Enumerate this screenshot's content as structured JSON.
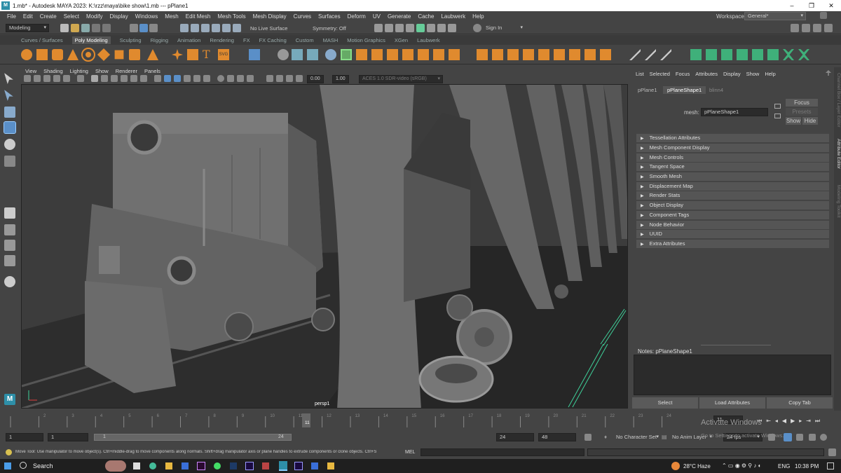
{
  "titlebar": {
    "title": "1.mb* - Autodesk MAYA 2023: K:\\rzz\\maya\\bike show\\1.mb  ---  pPlane1",
    "minimize": "–",
    "maximize": "❐",
    "close": "✕"
  },
  "menubar": [
    "File",
    "Edit",
    "Create",
    "Select",
    "Modify",
    "Display",
    "Windows",
    "Mesh",
    "Edit Mesh",
    "Mesh Tools",
    "Mesh Display",
    "Curves",
    "Surfaces",
    "Deform",
    "UV",
    "Generate",
    "Cache",
    "Laubwerk",
    "Help"
  ],
  "workspace": {
    "label": "Workspace:",
    "value": "General*"
  },
  "statusline": {
    "mode": "Modeling",
    "live_surface": "No Live Surface",
    "symmetry": "Symmetry: Off",
    "sign_in": "Sign In"
  },
  "shelf_tabs": [
    "Curves / Surfaces",
    "Poly Modeling",
    "Sculpting",
    "Rigging",
    "Animation",
    "Rendering",
    "FX",
    "FX Caching",
    "Custom",
    "MASH",
    "Motion Graphics",
    "XGen",
    "Laubwerk"
  ],
  "shelf_active": "Poly Modeling",
  "viewport": {
    "menu": [
      "View",
      "Shading",
      "Lighting",
      "Show",
      "Renderer",
      "Panels"
    ],
    "field_a": "0.00",
    "field_b": "1.00",
    "colorspace": "ACES 1.0 SDR-video (sRGB)",
    "camera_label": "persp1"
  },
  "attribute_editor": {
    "menu": [
      "List",
      "Selected",
      "Focus",
      "Attributes",
      "Display",
      "Show",
      "Help"
    ],
    "tabs": [
      "pPlane1",
      "pPlaneShape1",
      "blinn4"
    ],
    "active_tab": "pPlaneShape1",
    "mesh_label": "mesh:",
    "mesh_value": "pPlaneShape1",
    "focus": "Focus",
    "presets": "Presets",
    "show": "Show",
    "hide": "Hide",
    "sections": [
      "Tessellation Attributes",
      "Mesh Component Display",
      "Mesh Controls",
      "Tangent Space",
      "Smooth Mesh",
      "Displacement Map",
      "Render Stats",
      "Object Display",
      "Component Tags",
      "Node Behavior",
      "UUID",
      "Extra Attributes"
    ],
    "notes_label": "Notes:  pPlaneShape1",
    "buttons": [
      "Select",
      "Load Attributes",
      "Copy Tab"
    ]
  },
  "side_tabs": [
    "Channel Box / Layer Editor",
    "Attribute Editor",
    "Modeling Toolkit"
  ],
  "timeslider": {
    "ticks": [
      "1",
      "2",
      "3",
      "4",
      "5",
      "6",
      "7",
      "8",
      "9",
      "10",
      "11",
      "12",
      "13",
      "14",
      "15",
      "16",
      "17",
      "18",
      "19",
      "20",
      "21",
      "22",
      "23",
      "24"
    ],
    "current_frame": "11",
    "current_field": "11"
  },
  "range": {
    "start": "1",
    "start2": "1",
    "range_start_label": "1",
    "range_end_label": "24",
    "end": "24",
    "end2": "48",
    "character_set": "No Character Set",
    "anim_layer": "No Anim Layer",
    "fps": "24 fps"
  },
  "activate": {
    "title": "Activate Windows",
    "subtitle": "Go to Settings to activate Windows."
  },
  "helpline": "Move Tool: Use manipulator to move object(s). Ctrl+middle-drag to move components along normals. Shift+drag manipulator axis or plane handles to extrude components or clone objects. Ctrl+S",
  "cmd_label": "MEL",
  "taskbar": {
    "search": "Search",
    "weather": "28°C  Haze",
    "lang": "ENG",
    "time": "10:38 PM"
  },
  "colors": {
    "accent": "#5a8fc8",
    "green_edge": "#3fd19a",
    "viewport_bg": "#3c3c3c"
  }
}
